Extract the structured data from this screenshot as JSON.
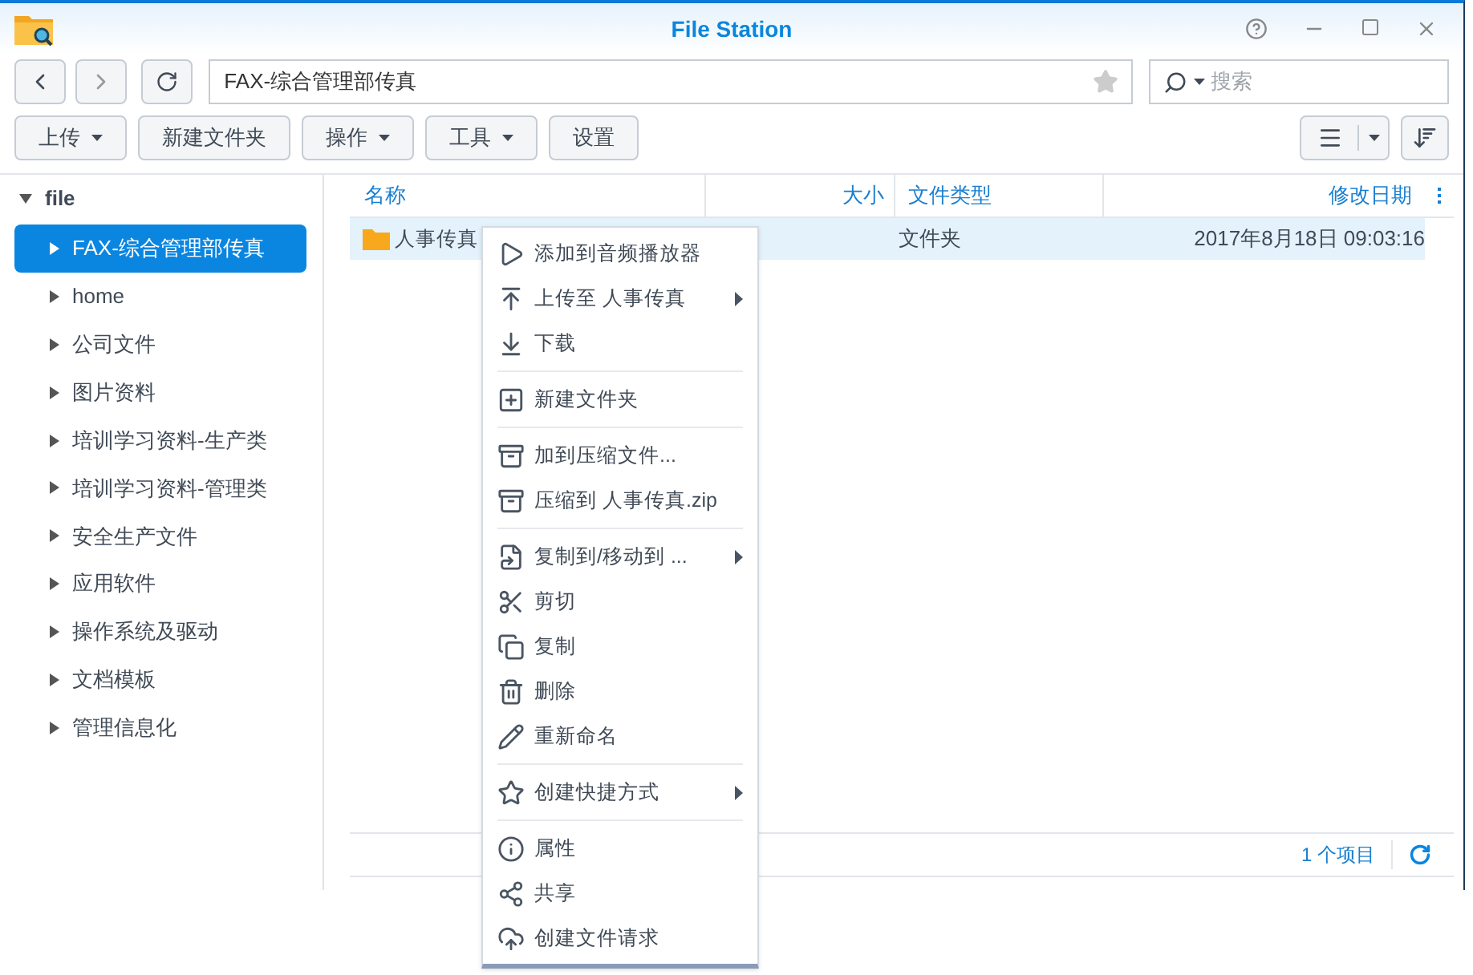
{
  "window": {
    "title": "File Station"
  },
  "nav": {
    "path": "FAX-综合管理部传真",
    "search_placeholder": "搜索"
  },
  "toolbar": [
    {
      "label": "上传",
      "dropdown": true
    },
    {
      "label": "新建文件夹",
      "dropdown": false
    },
    {
      "label": "操作",
      "dropdown": true
    },
    {
      "label": "工具",
      "dropdown": true
    },
    {
      "label": "设置",
      "dropdown": false
    }
  ],
  "sidebar": {
    "root": {
      "label": "file",
      "expanded": true
    },
    "items": [
      {
        "label": "FAX-综合管理部传真",
        "selected": true
      },
      {
        "label": "home",
        "selected": false
      },
      {
        "label": "公司文件",
        "selected": false
      },
      {
        "label": "图片资料",
        "selected": false
      },
      {
        "label": "培训学习资料-生产类",
        "selected": false
      },
      {
        "label": "培训学习资料-管理类",
        "selected": false
      },
      {
        "label": "安全生产文件",
        "selected": false
      },
      {
        "label": "应用软件",
        "selected": false
      },
      {
        "label": "操作系统及驱动",
        "selected": false
      },
      {
        "label": "文档模板",
        "selected": false
      },
      {
        "label": "管理信息化",
        "selected": false
      }
    ]
  },
  "table": {
    "columns": [
      "名称",
      "大小",
      "文件类型",
      "修改日期"
    ],
    "rows": [
      {
        "name": "人事传真",
        "type": "文件夹",
        "modified": "2017年8月18日 09:03:16",
        "selected": true
      }
    ]
  },
  "status_bar": {
    "count": "1 个项目"
  },
  "context_menu": {
    "groups": [
      [
        {
          "label": "添加到音频播放器",
          "kind": "play",
          "submenu": false
        },
        {
          "label": "上传至 人事传真",
          "kind": "upload",
          "submenu": true
        },
        {
          "label": "下载",
          "kind": "download",
          "submenu": false
        }
      ],
      [
        {
          "label": "新建文件夹",
          "kind": "newfolder",
          "submenu": false
        }
      ],
      [
        {
          "label": "加到压缩文件...",
          "kind": "archive",
          "submenu": false
        },
        {
          "label": "压缩到 人事传真.zip",
          "kind": "archive",
          "submenu": false
        }
      ],
      [
        {
          "label": "复制到/移动到 ...",
          "kind": "move",
          "submenu": true
        },
        {
          "label": "剪切",
          "kind": "cut",
          "submenu": false
        },
        {
          "label": "复制",
          "kind": "copy",
          "submenu": false
        },
        {
          "label": "删除",
          "kind": "delete",
          "submenu": false
        },
        {
          "label": "重新命名",
          "kind": "rename",
          "submenu": false
        }
      ],
      [
        {
          "label": "创建快捷方式",
          "kind": "shortcut",
          "submenu": true
        }
      ],
      [
        {
          "label": "属性",
          "kind": "info",
          "submenu": false
        },
        {
          "label": "共享",
          "kind": "share",
          "submenu": false
        },
        {
          "label": "创建文件请求",
          "kind": "cloudupload",
          "submenu": false
        }
      ]
    ]
  }
}
